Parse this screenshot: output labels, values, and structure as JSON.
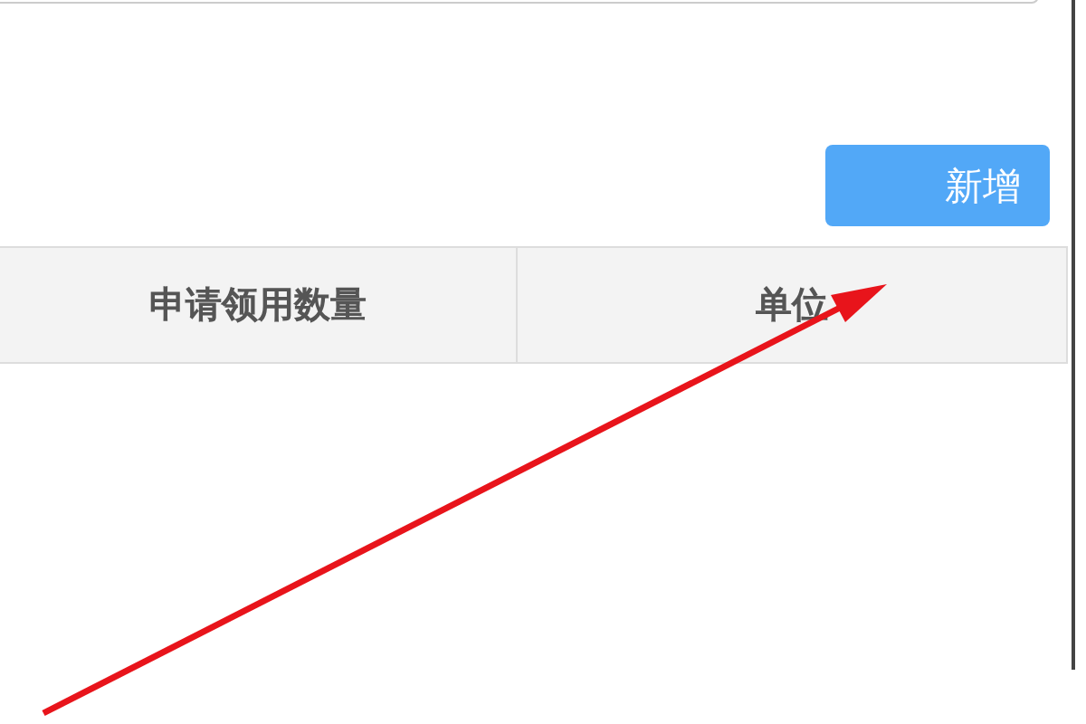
{
  "add_button": {
    "label": "新增"
  },
  "table": {
    "columns": [
      {
        "label": "申请领用数量"
      },
      {
        "label": "单位"
      }
    ]
  }
}
